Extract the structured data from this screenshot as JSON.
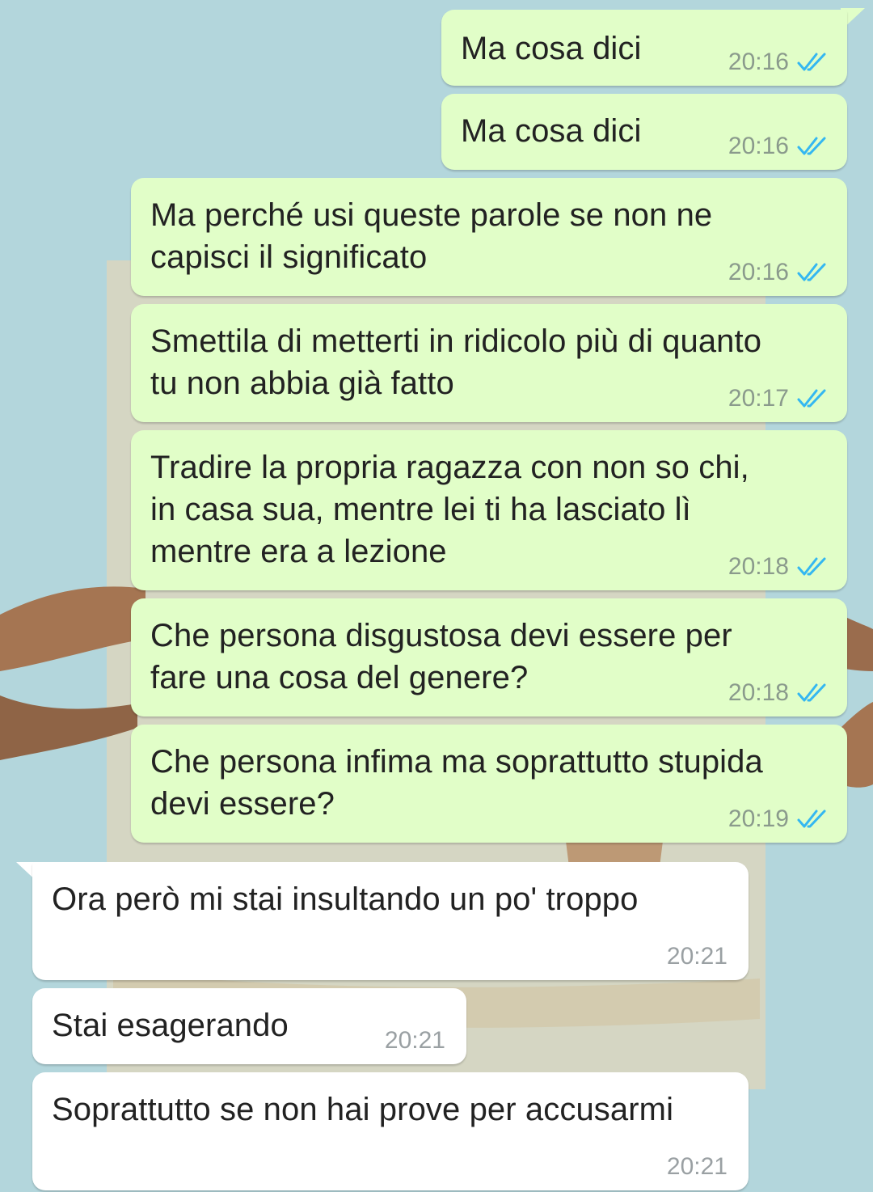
{
  "chat": {
    "messages": [
      {
        "direction": "out",
        "text": "Ma cosa dici",
        "time": "20:16",
        "status": "read"
      },
      {
        "direction": "out",
        "text": "Ma cosa dici",
        "time": "20:16",
        "status": "read"
      },
      {
        "direction": "out",
        "text": "Ma perché usi queste parole se non ne\ncapisci il significato",
        "time": "20:16",
        "status": "read"
      },
      {
        "direction": "out",
        "text": "Smettila di metterti in ridicolo più di quanto\ntu non abbia già fatto",
        "time": "20:17",
        "status": "read"
      },
      {
        "direction": "out",
        "text": "Tradire la propria ragazza con non so chi,\nin casa sua, mentre lei ti ha lasciato lì\nmentre era a lezione",
        "time": "20:18",
        "status": "read"
      },
      {
        "direction": "out",
        "text": "Che persona disgustosa devi essere per\nfare una cosa del genere?",
        "time": "20:18",
        "status": "read"
      },
      {
        "direction": "out",
        "text": "Che persona infima ma soprattutto stupida\ndevi essere?",
        "time": "20:19",
        "status": "read"
      },
      {
        "direction": "in",
        "text": "Ora però mi stai insultando un po' troppo",
        "time": "20:21"
      },
      {
        "direction": "in",
        "text": "Stai esagerando",
        "time": "20:21"
      },
      {
        "direction": "in",
        "text": "Soprattutto se non hai prove per accusarmi",
        "time": "20:21"
      }
    ]
  },
  "theme": {
    "outgoing_bubble": "#e1fec8",
    "incoming_bubble": "#ffffff",
    "wallpaper": "#b3d6dc",
    "read_tick": "#34b7f1",
    "icons": {
      "read_status": "double-check-icon"
    }
  }
}
